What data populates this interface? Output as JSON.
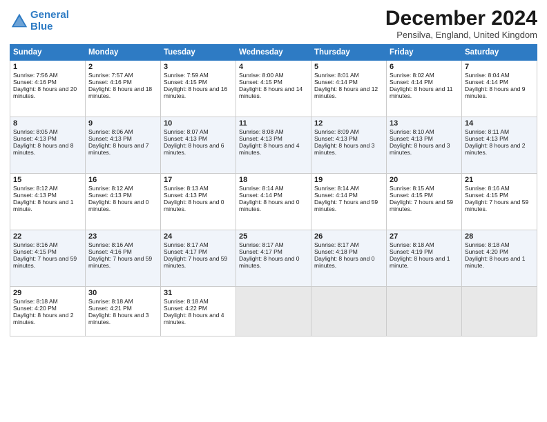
{
  "header": {
    "logo_line1": "General",
    "logo_line2": "Blue",
    "title": "December 2024",
    "location": "Pensilva, England, United Kingdom"
  },
  "days_of_week": [
    "Sunday",
    "Monday",
    "Tuesday",
    "Wednesday",
    "Thursday",
    "Friday",
    "Saturday"
  ],
  "weeks": [
    [
      {
        "day": "1",
        "sunrise": "Sunrise: 7:56 AM",
        "sunset": "Sunset: 4:16 PM",
        "daylight": "Daylight: 8 hours and 20 minutes."
      },
      {
        "day": "2",
        "sunrise": "Sunrise: 7:57 AM",
        "sunset": "Sunset: 4:16 PM",
        "daylight": "Daylight: 8 hours and 18 minutes."
      },
      {
        "day": "3",
        "sunrise": "Sunrise: 7:59 AM",
        "sunset": "Sunset: 4:15 PM",
        "daylight": "Daylight: 8 hours and 16 minutes."
      },
      {
        "day": "4",
        "sunrise": "Sunrise: 8:00 AM",
        "sunset": "Sunset: 4:15 PM",
        "daylight": "Daylight: 8 hours and 14 minutes."
      },
      {
        "day": "5",
        "sunrise": "Sunrise: 8:01 AM",
        "sunset": "Sunset: 4:14 PM",
        "daylight": "Daylight: 8 hours and 12 minutes."
      },
      {
        "day": "6",
        "sunrise": "Sunrise: 8:02 AM",
        "sunset": "Sunset: 4:14 PM",
        "daylight": "Daylight: 8 hours and 11 minutes."
      },
      {
        "day": "7",
        "sunrise": "Sunrise: 8:04 AM",
        "sunset": "Sunset: 4:14 PM",
        "daylight": "Daylight: 8 hours and 9 minutes."
      }
    ],
    [
      {
        "day": "8",
        "sunrise": "Sunrise: 8:05 AM",
        "sunset": "Sunset: 4:13 PM",
        "daylight": "Daylight: 8 hours and 8 minutes."
      },
      {
        "day": "9",
        "sunrise": "Sunrise: 8:06 AM",
        "sunset": "Sunset: 4:13 PM",
        "daylight": "Daylight: 8 hours and 7 minutes."
      },
      {
        "day": "10",
        "sunrise": "Sunrise: 8:07 AM",
        "sunset": "Sunset: 4:13 PM",
        "daylight": "Daylight: 8 hours and 6 minutes."
      },
      {
        "day": "11",
        "sunrise": "Sunrise: 8:08 AM",
        "sunset": "Sunset: 4:13 PM",
        "daylight": "Daylight: 8 hours and 4 minutes."
      },
      {
        "day": "12",
        "sunrise": "Sunrise: 8:09 AM",
        "sunset": "Sunset: 4:13 PM",
        "daylight": "Daylight: 8 hours and 3 minutes."
      },
      {
        "day": "13",
        "sunrise": "Sunrise: 8:10 AM",
        "sunset": "Sunset: 4:13 PM",
        "daylight": "Daylight: 8 hours and 3 minutes."
      },
      {
        "day": "14",
        "sunrise": "Sunrise: 8:11 AM",
        "sunset": "Sunset: 4:13 PM",
        "daylight": "Daylight: 8 hours and 2 minutes."
      }
    ],
    [
      {
        "day": "15",
        "sunrise": "Sunrise: 8:12 AM",
        "sunset": "Sunset: 4:13 PM",
        "daylight": "Daylight: 8 hours and 1 minute."
      },
      {
        "day": "16",
        "sunrise": "Sunrise: 8:12 AM",
        "sunset": "Sunset: 4:13 PM",
        "daylight": "Daylight: 8 hours and 0 minutes."
      },
      {
        "day": "17",
        "sunrise": "Sunrise: 8:13 AM",
        "sunset": "Sunset: 4:13 PM",
        "daylight": "Daylight: 8 hours and 0 minutes."
      },
      {
        "day": "18",
        "sunrise": "Sunrise: 8:14 AM",
        "sunset": "Sunset: 4:14 PM",
        "daylight": "Daylight: 8 hours and 0 minutes."
      },
      {
        "day": "19",
        "sunrise": "Sunrise: 8:14 AM",
        "sunset": "Sunset: 4:14 PM",
        "daylight": "Daylight: 7 hours and 59 minutes."
      },
      {
        "day": "20",
        "sunrise": "Sunrise: 8:15 AM",
        "sunset": "Sunset: 4:15 PM",
        "daylight": "Daylight: 7 hours and 59 minutes."
      },
      {
        "day": "21",
        "sunrise": "Sunrise: 8:16 AM",
        "sunset": "Sunset: 4:15 PM",
        "daylight": "Daylight: 7 hours and 59 minutes."
      }
    ],
    [
      {
        "day": "22",
        "sunrise": "Sunrise: 8:16 AM",
        "sunset": "Sunset: 4:15 PM",
        "daylight": "Daylight: 7 hours and 59 minutes."
      },
      {
        "day": "23",
        "sunrise": "Sunrise: 8:16 AM",
        "sunset": "Sunset: 4:16 PM",
        "daylight": "Daylight: 7 hours and 59 minutes."
      },
      {
        "day": "24",
        "sunrise": "Sunrise: 8:17 AM",
        "sunset": "Sunset: 4:17 PM",
        "daylight": "Daylight: 7 hours and 59 minutes."
      },
      {
        "day": "25",
        "sunrise": "Sunrise: 8:17 AM",
        "sunset": "Sunset: 4:17 PM",
        "daylight": "Daylight: 8 hours and 0 minutes."
      },
      {
        "day": "26",
        "sunrise": "Sunrise: 8:17 AM",
        "sunset": "Sunset: 4:18 PM",
        "daylight": "Daylight: 8 hours and 0 minutes."
      },
      {
        "day": "27",
        "sunrise": "Sunrise: 8:18 AM",
        "sunset": "Sunset: 4:19 PM",
        "daylight": "Daylight: 8 hours and 1 minute."
      },
      {
        "day": "28",
        "sunrise": "Sunrise: 8:18 AM",
        "sunset": "Sunset: 4:20 PM",
        "daylight": "Daylight: 8 hours and 1 minute."
      }
    ],
    [
      {
        "day": "29",
        "sunrise": "Sunrise: 8:18 AM",
        "sunset": "Sunset: 4:20 PM",
        "daylight": "Daylight: 8 hours and 2 minutes."
      },
      {
        "day": "30",
        "sunrise": "Sunrise: 8:18 AM",
        "sunset": "Sunset: 4:21 PM",
        "daylight": "Daylight: 8 hours and 3 minutes."
      },
      {
        "day": "31",
        "sunrise": "Sunrise: 8:18 AM",
        "sunset": "Sunset: 4:22 PM",
        "daylight": "Daylight: 8 hours and 4 minutes."
      },
      null,
      null,
      null,
      null
    ]
  ]
}
